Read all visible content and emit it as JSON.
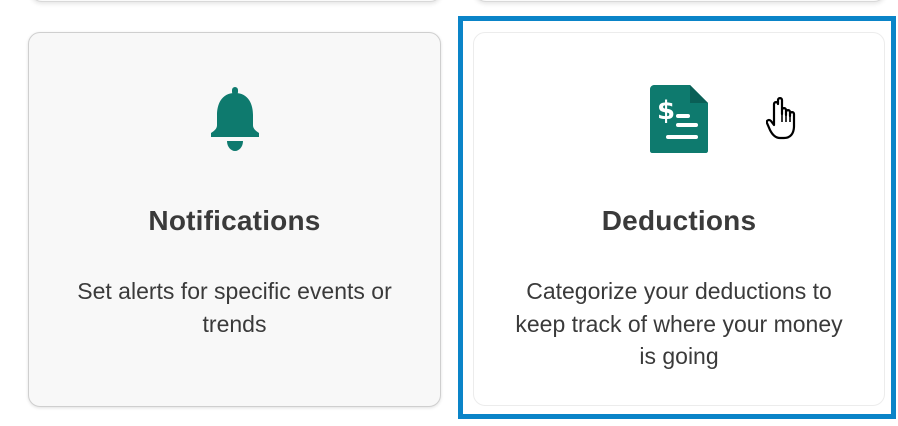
{
  "cards": [
    {
      "title": "Notifications",
      "description": "Set alerts for specific events or trends",
      "icon": "bell-icon"
    },
    {
      "title": "Deductions",
      "description": "Categorize your deductions to keep track of where your money is going",
      "icon": "receipt-dollar-icon",
      "focused": true
    }
  ],
  "colors": {
    "icon": "#0e7a6e",
    "focus_ring": "#0a84c8",
    "text": "#3a3a3a"
  },
  "cursor": "hand-pointer-icon"
}
